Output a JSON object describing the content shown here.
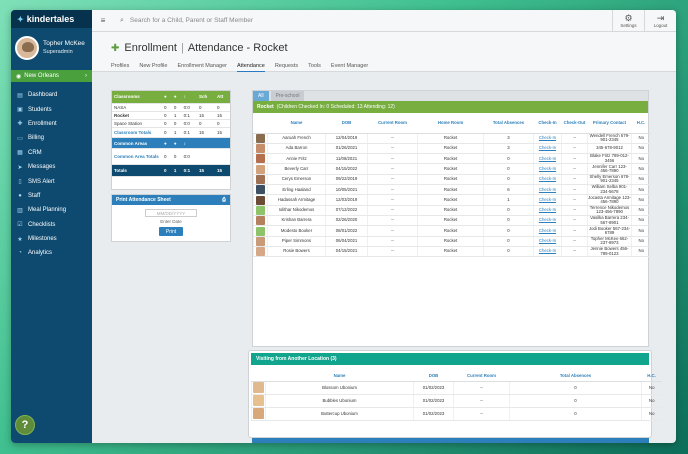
{
  "brand": {
    "name": "kindertales"
  },
  "user": {
    "name": "Topher McKee",
    "role": "Superadmin"
  },
  "location": {
    "name": "New Orleans"
  },
  "sidebar": {
    "items": [
      {
        "label": "Dashboard",
        "icon": "dashboard-icon",
        "glyph": "▤"
      },
      {
        "label": "Students",
        "icon": "students-icon",
        "glyph": "▣"
      },
      {
        "label": "Enrollment",
        "icon": "enrollment-icon",
        "glyph": "✚"
      },
      {
        "label": "Billing",
        "icon": "billing-icon",
        "glyph": "▭"
      },
      {
        "label": "CRM",
        "icon": "crm-icon",
        "glyph": "▦"
      },
      {
        "label": "Messages",
        "icon": "messages-icon",
        "glyph": "➤"
      },
      {
        "label": "SMS Alert",
        "icon": "sms-icon",
        "glyph": "▯"
      },
      {
        "label": "Staff",
        "icon": "staff-icon",
        "glyph": "●"
      },
      {
        "label": "Meal Planning",
        "icon": "meal-icon",
        "glyph": "▥"
      },
      {
        "label": "Checklists",
        "icon": "checklist-icon",
        "glyph": "☑"
      },
      {
        "label": "Milestones",
        "icon": "milestones-icon",
        "glyph": "★"
      },
      {
        "label": "Analytics",
        "icon": "analytics-icon",
        "glyph": "◔"
      }
    ]
  },
  "help": {
    "label": "?"
  },
  "topbar": {
    "search_placeholder": "Search for a Child, Parent or Staff Member",
    "settings": "Settings",
    "logout": "Logout"
  },
  "page": {
    "section": "Enrollment",
    "title": "Attendance - Rocket"
  },
  "tabs": [
    "Profiles",
    "New Profile",
    "Enrollment Manager",
    "Attendance",
    "Requests",
    "Tools",
    "Event Manager"
  ],
  "classrooms": {
    "header": "Classrooms",
    "cols": [
      "",
      "",
      "",
      "Sch",
      "Att"
    ],
    "rows": [
      {
        "name": "NASA",
        "a": "0",
        "b": "0",
        "c": "0:0",
        "d": "0",
        "e": "0"
      },
      {
        "name": "Rocket",
        "a": "0",
        "b": "1",
        "c": "0:1",
        "d": "15",
        "e": "15"
      },
      {
        "name": "Space Station",
        "a": "0",
        "b": "0",
        "c": "0:0",
        "d": "0",
        "e": "0"
      }
    ],
    "totals": {
      "name": "Classroom Totals",
      "a": "0",
      "b": "1",
      "c": "0:1",
      "d": "15",
      "e": "15"
    }
  },
  "common": {
    "header": "Common Areas",
    "row": {
      "name": "Common Area Totals",
      "a": "0",
      "b": "0",
      "c": "0:0"
    },
    "totals": {
      "name": "Totals",
      "a": "0",
      "b": "1",
      "c": "0:1",
      "d": "15",
      "e": "15"
    }
  },
  "print": {
    "header": "Print Attendance Sheet",
    "placeholder": "MM/DD/YYYY",
    "label": "Enter Date",
    "button": "Print"
  },
  "room": {
    "subtabs": [
      "All",
      "Pre-school"
    ],
    "name": "Rocket",
    "summary": "(Children Checked In: 0   Scheduled: 13   Attending: 12)",
    "columns": [
      "",
      "Name",
      "DOB",
      "Current Room",
      "Home Room",
      "Total Absences",
      "Check-In",
      "Check-Out",
      "Primary Contact",
      "H.C."
    ],
    "rows": [
      {
        "name": "Aaruah French",
        "dob": "12/04/2019",
        "cur": "--",
        "home": "Rocket",
        "abs": "3",
        "in": "Check-In",
        "out": "--",
        "contact": "Wendell French 679-901-2345",
        "hc": "No",
        "photo": "#8a6c4f"
      },
      {
        "name": "Ada Barron",
        "dob": "01/26/2021",
        "cur": "--",
        "home": "Rocket",
        "abs": "3",
        "in": "Check-In",
        "out": "--",
        "contact": "345-678-9012",
        "hc": "No",
        "photo": "#c58d6a"
      },
      {
        "name": "Annie Fritz",
        "dob": "11/08/2021",
        "cur": "--",
        "home": "Rocket",
        "abs": "0",
        "in": "Check-In",
        "out": "--",
        "contact": "Blake Fritz 789-012-3456",
        "hc": "No",
        "photo": "#b66f4e"
      },
      {
        "name": "Beverly Carr",
        "dob": "04/15/2022",
        "cur": "--",
        "home": "Rocket",
        "abs": "0",
        "in": "Check-In",
        "out": "--",
        "contact": "Jennifer Carr 123-456-7890",
        "hc": "No",
        "photo": "#d1a27c"
      },
      {
        "name": "Cerys Emerson",
        "dob": "09/22/2019",
        "cur": "--",
        "home": "Rocket",
        "abs": "0",
        "in": "Check-In",
        "out": "--",
        "contact": "Shelly Emerson 678-901-2345",
        "hc": "No",
        "photo": "#a07052"
      },
      {
        "name": "Erling Haaland",
        "dob": "10/05/2021",
        "cur": "--",
        "home": "Rocket",
        "abs": "6",
        "in": "Check-In",
        "out": "--",
        "contact": "William Selba 901-234-5678",
        "hc": "No",
        "photo": "#3d4f63"
      },
      {
        "name": "Hadassah Armitage",
        "dob": "12/03/2019",
        "cur": "--",
        "home": "Rocket",
        "abs": "1",
        "in": "Check-In",
        "out": "--",
        "contact": "Jocasta Armitage 123-456-7890",
        "hc": "No",
        "photo": "#6b4a36"
      },
      {
        "name": "Iolithar Nikodemos",
        "dob": "07/12/2022",
        "cur": "--",
        "home": "Rocket",
        "abs": "0",
        "in": "Check-In",
        "out": "--",
        "contact": "Terrence Nikodemos 123-456-7890",
        "hc": "No",
        "photo": "#8fc36a"
      },
      {
        "name": "Krishan Barrera",
        "dob": "02/26/2020",
        "cur": "--",
        "home": "Rocket",
        "abs": "0",
        "in": "Check-In",
        "out": "--",
        "contact": "Vasilka Barrera 234-567-8901",
        "hc": "No",
        "photo": "#b5805e"
      },
      {
        "name": "Modesto Booker",
        "dob": "08/01/2022",
        "cur": "--",
        "home": "Rocket",
        "abs": "0",
        "in": "Check-In",
        "out": "--",
        "contact": "Jodi Booker 567-234-6789",
        "hc": "No",
        "photo": "#8fc36a"
      },
      {
        "name": "Piper Simmons",
        "dob": "06/04/2021",
        "cur": "--",
        "home": "Rocket",
        "abs": "0",
        "in": "Check-In",
        "out": "--",
        "contact": "Topher McKee 662-237-8973",
        "hc": "No",
        "photo": "#c99a78"
      },
      {
        "name": "Rosie Bowers",
        "dob": "04/15/2021",
        "cur": "--",
        "home": "Rocket",
        "abs": "0",
        "in": "Check-In",
        "out": "--",
        "contact": "Jennie Bowers 456-789-0123",
        "hc": "No",
        "photo": "#d6a888"
      }
    ]
  },
  "visiting": {
    "header": "Visiting from Another Location (3)",
    "columns": [
      "",
      "Name",
      "DOB",
      "Current Room",
      "Total Absences",
      "H.C."
    ],
    "rows": [
      {
        "name": "Blossom Ubonium",
        "dob": "01/02/2023",
        "cur": "--",
        "abs": "0",
        "hc": "No",
        "photo": "#e0b98f"
      },
      {
        "name": "Bubbles Ubonium",
        "dob": "01/02/2023",
        "cur": "--",
        "abs": "0",
        "hc": "No",
        "photo": "#e7c08f"
      },
      {
        "name": "Buttercup Ubonium",
        "dob": "01/02/2023",
        "cur": "--",
        "abs": "0",
        "hc": "No",
        "photo": "#d9a87a"
      }
    ]
  },
  "colors": {
    "sidebar": "#0e4a6f",
    "green": "#77ae3f",
    "blue": "#2c7fba",
    "teal": "#12a58d"
  }
}
